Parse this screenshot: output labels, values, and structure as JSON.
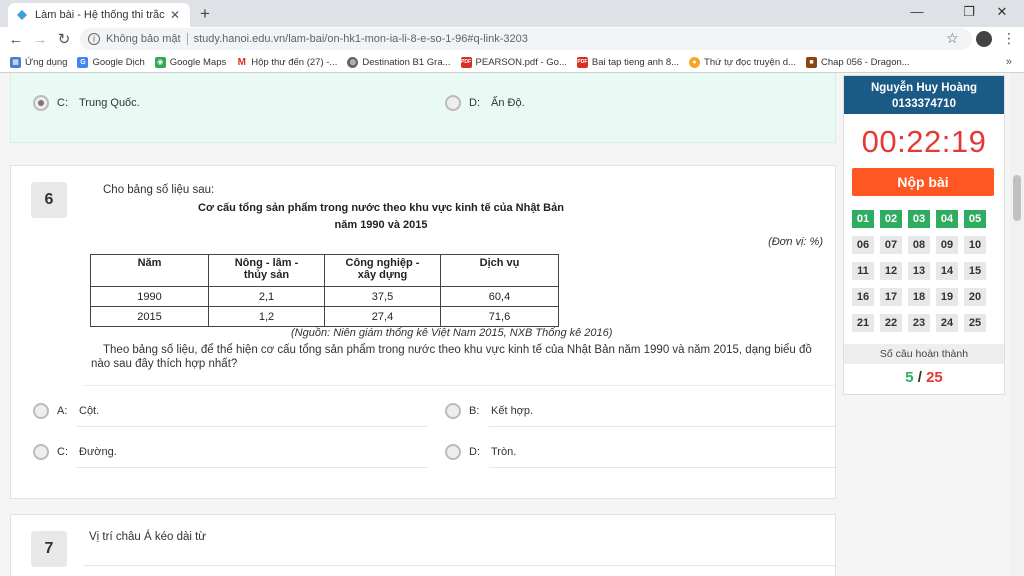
{
  "browser": {
    "tab_title": "Làm bài - Hệ thống thi trắc nghiệ",
    "security": "Không bảo mật",
    "url": "study.hanoi.edu.vn/lam-bai/on-hk1-mon-ia-li-8-e-so-1-96#q-link-3203",
    "bookmarks": [
      "Ứng dụng",
      "Google Dịch",
      "Google Maps",
      "Hộp thư đến (27) -...",
      "Destination B1 Gra...",
      "PEARSON.pdf - Go...",
      "Bai tap tieng anh 8...",
      "Thứ tự đọc truyện d...",
      "Chap 056 - Dragon..."
    ],
    "more": "»"
  },
  "prev_question": {
    "options": [
      {
        "letter": "C:",
        "text": "Trung Quốc.",
        "checked": true
      },
      {
        "letter": "D:",
        "text": "Ấn Độ.",
        "checked": false
      }
    ]
  },
  "question6": {
    "number": "6",
    "intro": "Cho bảng số liệu sau:",
    "table_title_1": "Cơ cấu tổng sản phẩm trong nước theo khu vực kinh tế của Nhật Bản",
    "table_title_2": "năm 1990 và 2015",
    "unit": "(Đơn vị: %)",
    "headers": [
      "Năm",
      "Nông - lâm -\nthủy sản",
      "Công nghiệp -\nxây dựng",
      "Dịch vụ"
    ],
    "rows": [
      [
        "1990",
        "2,1",
        "37,5",
        "60,4"
      ],
      [
        "2015",
        "1,2",
        "27,4",
        "71,6"
      ]
    ],
    "source": "(Nguồn: Niên giám thống kê Việt Nam 2015, NXB Thống kê 2016)",
    "text": "Theo bảng số liệu, để thể hiện cơ cấu tổng sản phẩm trong nước theo khu vực kinh tế của Nhật Bản năm 1990 và năm 2015, dạng biểu đồ nào sau đây thích hợp nhất?",
    "options": [
      {
        "letter": "A:",
        "text": "Cột."
      },
      {
        "letter": "B:",
        "text": "Kết hợp."
      },
      {
        "letter": "C:",
        "text": "Đường."
      },
      {
        "letter": "D:",
        "text": "Tròn."
      }
    ]
  },
  "question7": {
    "number": "7",
    "text": "Vị trí châu Á kéo dài từ"
  },
  "sidebar": {
    "name": "Nguyễn Huy Hoàng",
    "id": "0133374710",
    "timer": "00:22:19",
    "submit": "Nộp bài",
    "cells": [
      "01",
      "02",
      "03",
      "04",
      "05",
      "06",
      "07",
      "08",
      "09",
      "10",
      "11",
      "12",
      "13",
      "14",
      "15",
      "16",
      "17",
      "18",
      "19",
      "20",
      "21",
      "22",
      "23",
      "24",
      "25"
    ],
    "done_count": 5,
    "done_label": "Số câu hoàn thành",
    "answered": "5",
    "slash": "/",
    "total": "25"
  }
}
